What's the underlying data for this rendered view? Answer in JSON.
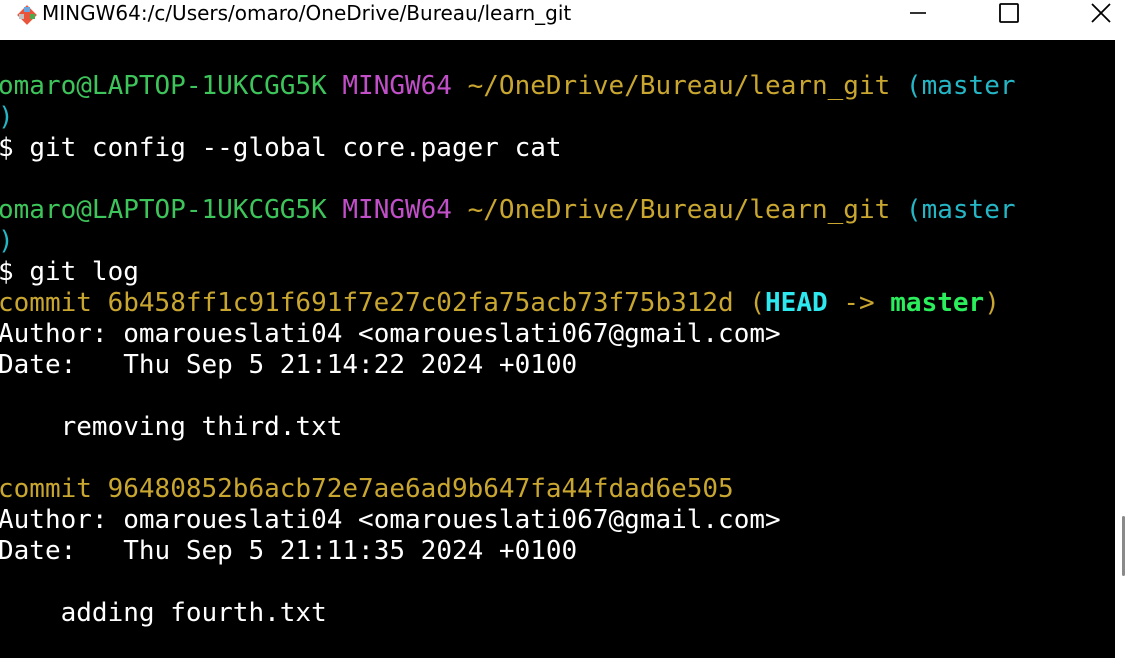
{
  "window": {
    "title": "MINGW64:/c/Users/omaro/OneDrive/Bureau/learn_git",
    "minimize_glyph": "—",
    "maximize_glyph": "☐",
    "close_glyph": "✕"
  },
  "terminal": {
    "prompt": {
      "user_host": "omaro@LAPTOP-1UKCGG5K",
      "env": "MINGW64",
      "path": "~/OneDrive/Bureau/learn_git",
      "branch_open": "(master",
      "branch_close": ")",
      "dollar": "$"
    },
    "commands": [
      "git config --global core.pager cat",
      "git log"
    ],
    "commits": [
      {
        "commit_word": "commit",
        "hash": "6b458ff1c91f691f7e27c02fa75acb73f75b312d",
        "ref_open": "(",
        "head": "HEAD",
        "arrow": "->",
        "branch": "master",
        "ref_close": ")",
        "author_label": "Author:",
        "author": "omaroueslati04 <omaroueslati067@gmail.com>",
        "date_label": "Date:",
        "date": "Thu Sep 5 21:14:22 2024 +0100",
        "message": "removing third.txt"
      },
      {
        "commit_word": "commit",
        "hash": "96480852b6acb72e7ae6ad9b647fa44fdad6e505",
        "author_label": "Author:",
        "author": "omaroueslati04 <omaroueslati067@gmail.com>",
        "date_label": "Date:",
        "date": "Thu Sep 5 21:11:35 2024 +0100",
        "message": "adding fourth.txt"
      }
    ]
  }
}
